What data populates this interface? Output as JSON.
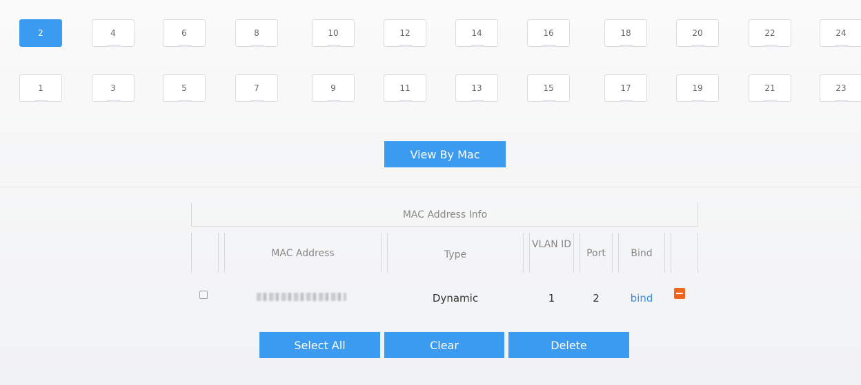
{
  "ports": {
    "top_row": [
      "2",
      "4",
      "6",
      "8",
      "10",
      "12",
      "14",
      "16",
      "18",
      "20",
      "22",
      "24"
    ],
    "bottom_row": [
      "1",
      "3",
      "5",
      "7",
      "9",
      "11",
      "13",
      "15",
      "17",
      "19",
      "21",
      "23"
    ],
    "selected": "2"
  },
  "view_button": "View By Mac",
  "table": {
    "title": "MAC Address Info",
    "headers": {
      "mac": "MAC Address",
      "type": "Type",
      "vlan": "VLAN ID",
      "port": "Port",
      "bind": "Bind"
    },
    "rows": [
      {
        "mac": "",
        "type": "Dynamic",
        "vlan": "1",
        "port": "2",
        "bind": "bind"
      }
    ]
  },
  "actions": {
    "select_all": "Select All",
    "clear": "Clear",
    "delete": "Delete"
  },
  "colors": {
    "accent": "#3b9bf0",
    "remove": "#f0661f"
  }
}
